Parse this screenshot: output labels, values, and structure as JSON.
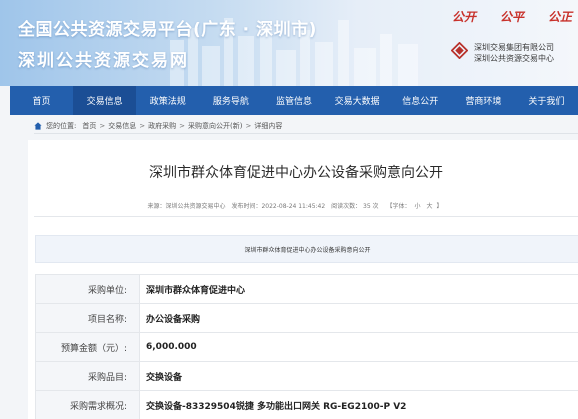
{
  "header": {
    "title_line1": "全国公共资源交易平台(广东 · 深圳市)",
    "title_line2": "深圳公共资源交易网",
    "slogan": [
      "公开",
      "公平",
      "公正"
    ],
    "org_lines": [
      "深圳交易集团有限公司",
      "深圳公共资源交易中心"
    ]
  },
  "nav": {
    "items": [
      "首页",
      "交易信息",
      "政策法规",
      "服务导航",
      "监管信息",
      "交易大数据",
      "信息公开",
      "营商环境",
      "关于我们"
    ],
    "active_index": 1
  },
  "breadcrumb": {
    "prefix": "您的位置:",
    "items": [
      "首页",
      "交易信息",
      "政府采购",
      "采购意向公开(新)",
      "详细内容"
    ]
  },
  "article": {
    "title": "深圳市群众体育促进中心办公设备采购意向公开",
    "meta": {
      "source": "来源：深圳公共资源交易中心",
      "published": "发布时间：2022-08-24 11:45:42",
      "views": "阅读次数： 35 次",
      "font_size_label": "【字体：",
      "font_small": "小",
      "font_large": "大",
      "font_size_close": "】"
    },
    "doc_title": "深圳市群众体育促进中心办公设备采购意向公开",
    "rows": [
      {
        "label": "采购单位:",
        "value": "深圳市群众体育促进中心"
      },
      {
        "label": "项目名称:",
        "value": "办公设备采购"
      },
      {
        "label": "预算金额（元）:",
        "value": "6,000.000"
      },
      {
        "label": "采购品目:",
        "value": "交换设备"
      },
      {
        "label": "采购需求概况:",
        "value": "交换设备-83329504锐捷 多功能出口网关 RG-EG2100-P V2"
      }
    ]
  },
  "colors": {
    "nav_bg": "#235fad",
    "slogan": "#c8312b"
  }
}
